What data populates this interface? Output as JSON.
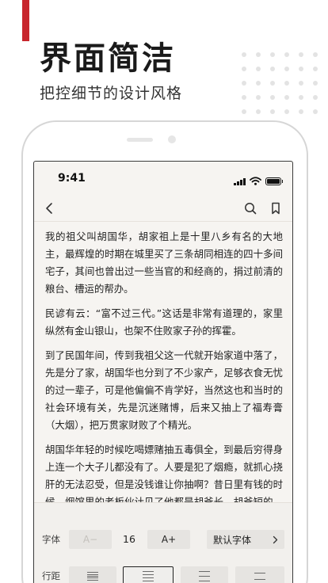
{
  "promo": {
    "headline": "界面简洁",
    "subline": "把控细节的设计风格"
  },
  "status_bar": {
    "time": "9:41"
  },
  "reader": {
    "paragraphs": [
      "我的祖父叫胡国华，胡家祖上是十里八乡有名的大地主，最辉煌的时期在城里买了三条胡同相连的四十多间宅子，其间也曾出过一些当官的和经商的，捐过前清的粮台、槽运的帮办。",
      "民谚有云：“富不过三代。”这话是非常有道理的，家里纵然有金山银山，也架不住败家子孙的挥霍。",
      "到了民国年间，传到我祖父这一代就开始家道中落了，先是分了家，胡国华也分到了不少家产，足够衣食无忧的过一辈子，可是他偏偏不肯学好，当然这也和当时的社会环境有关，先是沉迷赌博，后来又抽上了福寿膏（大烟），把万贯家财败了个精光。",
      "胡国华年轻的时候吃喝嫖赌抽五毒俱全，到最后穷得身上连一个大子儿都没有了。人要是犯了烟瘾，就抓心挠肝的无法忍受，但是没钱谁让你抽啊？昔日里有钱的时候，烟馆里的老板伙计见了他都是胡爷长，胡爷短的，招呼得殷勤周到，可是一但你身无分文了，他们就拿你当臭要饭的，连哄带赶，驱之不及。"
    ]
  },
  "settings": {
    "font_label": "字体",
    "decrease_label": "A−",
    "size_value": "16",
    "increase_label": "A+",
    "font_family_label": "默认字体",
    "spacing_label": "行距"
  }
}
